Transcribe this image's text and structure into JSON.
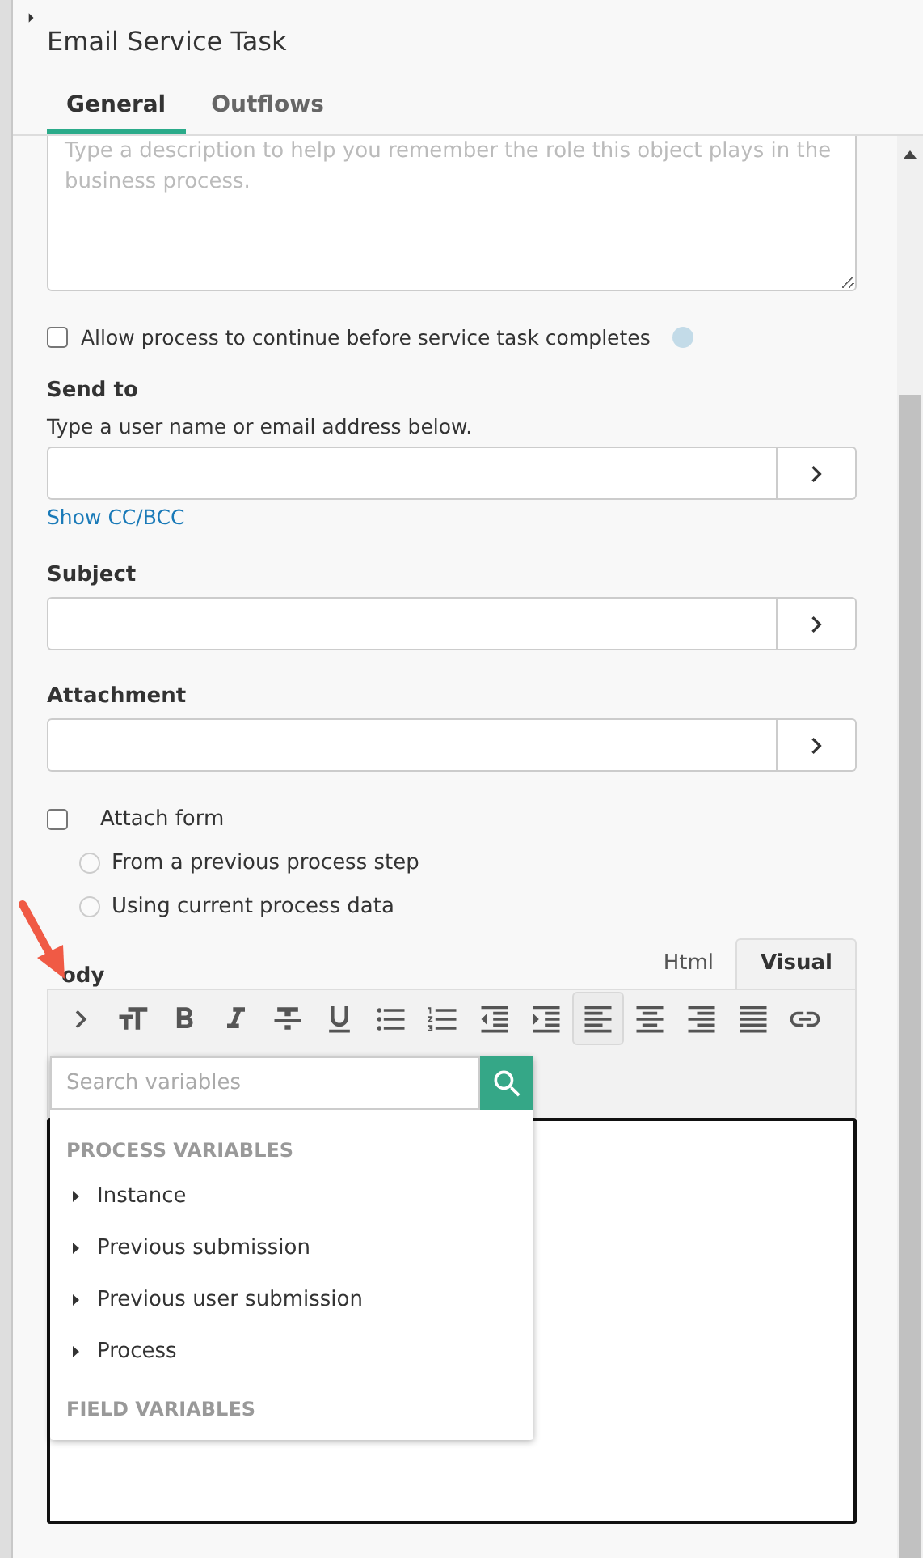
{
  "panel": {
    "title": "Email Service Task"
  },
  "tabs": [
    {
      "label": "General",
      "selected": true
    },
    {
      "label": "Outflows",
      "selected": false
    }
  ],
  "description": {
    "placeholder": "Type a description to help you remember the role this object plays in the business process."
  },
  "allow_continue": {
    "label": "Allow process to continue before service task completes",
    "checked": false
  },
  "send_to": {
    "label": "Send to",
    "hint": "Type a user name or email address below.",
    "link": "Show CC/BCC"
  },
  "subject": {
    "label": "Subject"
  },
  "attachment": {
    "label": "Attachment"
  },
  "attach_form": {
    "label": "Attach form",
    "checked": false,
    "options": [
      {
        "label": "From a previous process step",
        "selected": false
      },
      {
        "label": "Using current process data",
        "selected": false
      }
    ]
  },
  "body": {
    "label": "ody",
    "editor_tabs": [
      {
        "label": "Html",
        "selected": false
      },
      {
        "label": "Visual",
        "selected": true
      }
    ],
    "toolbar": [
      {
        "kind": "variables",
        "selected": false
      },
      {
        "kind": "size",
        "selected": false
      },
      {
        "kind": "bold",
        "selected": false
      },
      {
        "kind": "italic",
        "selected": false
      },
      {
        "kind": "strike",
        "selected": false
      },
      {
        "kind": "underline",
        "selected": false
      },
      {
        "kind": "bullets",
        "selected": false
      },
      {
        "kind": "numbers",
        "selected": false
      },
      {
        "kind": "outdent",
        "selected": false
      },
      {
        "kind": "indent",
        "selected": false
      },
      {
        "kind": "align-left",
        "selected": true
      },
      {
        "kind": "align-center",
        "selected": false
      },
      {
        "kind": "align-right",
        "selected": false
      },
      {
        "kind": "justify",
        "selected": false
      },
      {
        "kind": "link",
        "selected": false
      }
    ]
  },
  "variables_menu": {
    "placeholder": "Search variables",
    "sections": [
      {
        "heading": "PROCESS VARIABLES",
        "items": [
          {
            "label": "Instance",
            "expanded": false
          },
          {
            "label": "Previous submission",
            "expanded": false
          },
          {
            "label": "Previous user submission",
            "expanded": false
          },
          {
            "label": "Process",
            "expanded": false
          }
        ]
      },
      {
        "heading": "FIELD VARIABLES"
      }
    ]
  }
}
